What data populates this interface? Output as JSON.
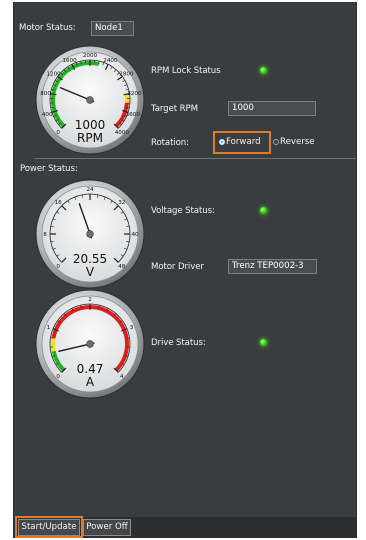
{
  "motor": {
    "status_label": "Motor Status:",
    "node_value": "Node1",
    "rpm_lock_label": "RPM Lock Status",
    "target_rpm_label": "Target RPM",
    "target_rpm_value": "1000",
    "rotation_label": "Rotation:",
    "rotation_options": [
      "Forward",
      "Reverse"
    ],
    "rotation_selected": "Forward"
  },
  "rpm_gauge": {
    "ticks": [
      "0",
      "400",
      "800",
      "1200",
      "1600",
      "2000",
      "2400",
      "2800",
      "3200",
      "3600",
      "4000"
    ],
    "value": "1000",
    "unit": "RPM",
    "needle_value": 1000,
    "min": 0,
    "max": 4000
  },
  "power": {
    "status_label": "Power Status:",
    "voltage_label": "Voltage Status:",
    "driver_label": "Motor Driver",
    "driver_value": "Trenz TEP0002-3",
    "drive_label": "Drive Status:"
  },
  "voltage_gauge": {
    "ticks": [
      "0",
      "8",
      "16",
      "24",
      "32",
      "40",
      "48"
    ],
    "value": "20.55",
    "unit": "V",
    "needle_value": 20.55,
    "min": 0,
    "max": 48
  },
  "current_gauge": {
    "ticks": [
      "0",
      "1",
      "2",
      "3",
      "4"
    ],
    "value": "0.47",
    "unit": "A",
    "needle_value": 0.47,
    "min": 0,
    "max": 4
  },
  "colors": {
    "background": "#3a3d3f",
    "led_on": "#3cdc1c",
    "highlight": "#e07b2a",
    "zone_green": "#1fb51f",
    "zone_yellow": "#f2e21a",
    "zone_red": "#e01e1e"
  },
  "buttons": {
    "start_update": "Start/Update",
    "power_off": "Power Off"
  }
}
